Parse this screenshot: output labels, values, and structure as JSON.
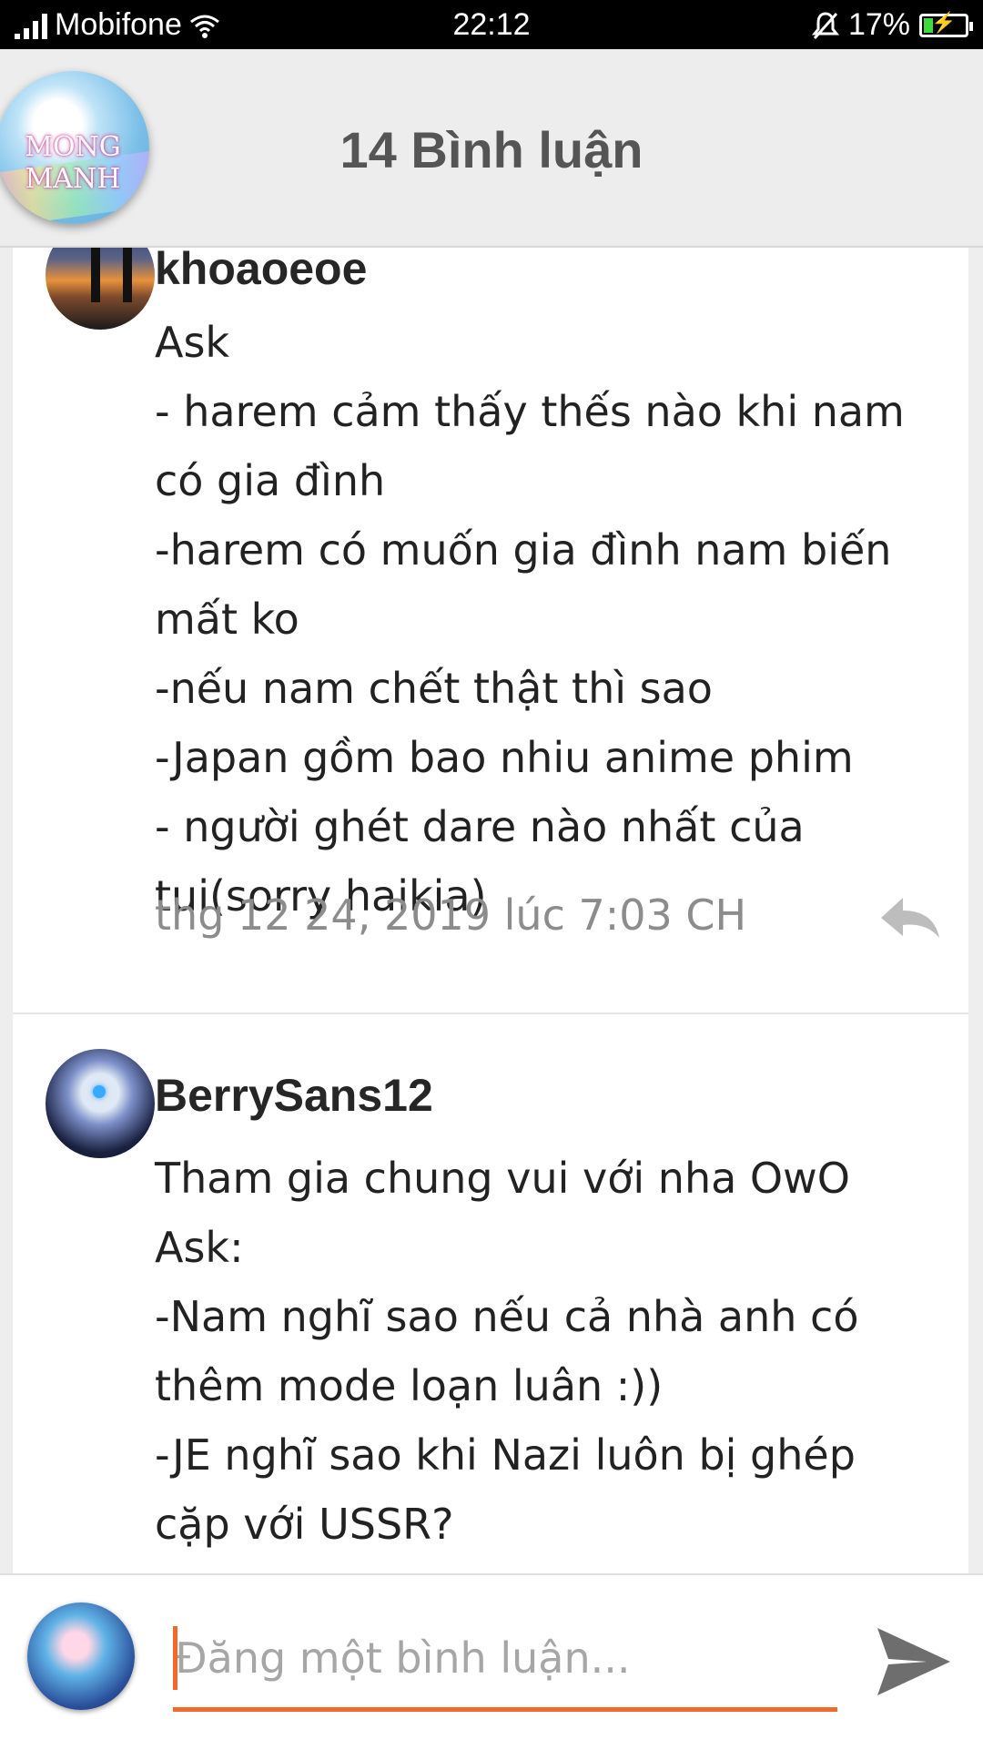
{
  "status_bar": {
    "carrier": "Mobifone",
    "time": "22:12",
    "battery": "17%"
  },
  "header": {
    "title": "14 Bình luận",
    "avatar_text": "MONG MANH"
  },
  "comments": [
    {
      "username": "khoaoeoe",
      "lines": [
        "Ask",
        "- harem cảm thấy thếs nào khi nam",
        "có gia đình",
        "-harem có muốn gia đình nam biến",
        "mất ko",
        "-nếu nam chết thật thì sao",
        "-Japan gồm bao nhiu anime phim",
        "- người ghét dare nào nhất của",
        "tui(sorry haikia)"
      ],
      "timestamp": "thg 12 24, 2019 lúc 7:03 CH"
    },
    {
      "username": "BerrySans12",
      "lines": [
        "Tham gia chung vui với nha OwO",
        "Ask:",
        "-Nam nghĩ sao nếu cả nhà anh có",
        "thêm mode loạn luân :))",
        "-JE nghĩ sao khi Nazi luôn bị ghép",
        "cặp với USSR?"
      ]
    }
  ],
  "composer": {
    "placeholder": "Đăng một bình luận..."
  },
  "colors": {
    "accent": "#f26a2a",
    "header_bg": "#ededed",
    "timestamp": "#8c8c8c"
  }
}
